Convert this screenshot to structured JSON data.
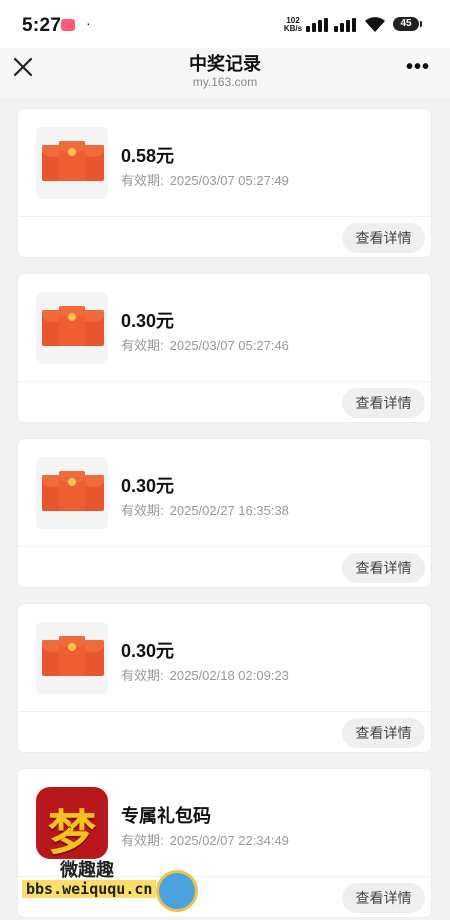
{
  "status_bar": {
    "time": "5:27",
    "dot": "·",
    "net_speed_value": "102",
    "net_speed_unit": "KB/s",
    "battery": "45"
  },
  "header": {
    "title": "中奖记录",
    "subtitle": "my.163.com"
  },
  "records": [
    {
      "amount": "0.58元",
      "validity_label": "有效期:",
      "validity_date": "2025/03/07 05:27:49",
      "button": "查看详情"
    },
    {
      "amount": "0.30元",
      "validity_label": "有效期:",
      "validity_date": "2025/03/07 05:27:46",
      "button": "查看详情"
    },
    {
      "amount": "0.30元",
      "validity_label": "有效期:",
      "validity_date": "2025/02/27 16:35:38",
      "button": "查看详情"
    },
    {
      "amount": "0.30元",
      "validity_label": "有效期:",
      "validity_date": "2025/02/18 02:09:23",
      "button": "查看详情"
    },
    {
      "amount": "专属礼包码",
      "validity_label": "有效期:",
      "validity_date": "2025/02/07 22:34:49",
      "button": "查看详情",
      "icon_glyph": "梦"
    }
  ],
  "watermark": {
    "text": "微趣趣",
    "url": "bbs.weiququ.cn"
  },
  "colors": {
    "envelope": "#e8562f",
    "game_icon_bg": "#b8171b",
    "game_icon_glyph": "#f7c21d",
    "button_bg": "#efefef"
  }
}
